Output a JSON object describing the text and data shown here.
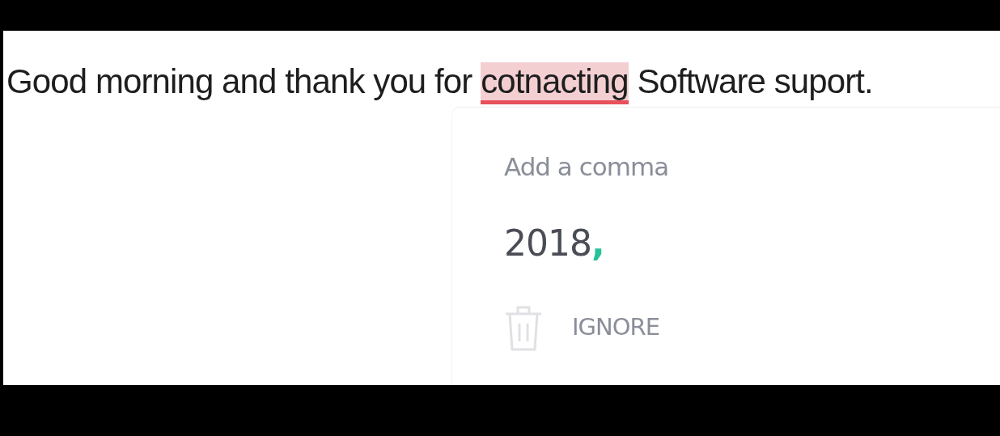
{
  "document": {
    "segments": [
      {
        "text": "Good morning and thank you for ",
        "flagged": false
      },
      {
        "text": "cotnacting",
        "flagged": true
      },
      {
        "text": " Software suport.",
        "flagged": false
      }
    ]
  },
  "suggestion_card": {
    "title": "Add a comma",
    "replacement": {
      "text": "2018",
      "insertion": ","
    },
    "ignore_label": "IGNORE"
  }
}
